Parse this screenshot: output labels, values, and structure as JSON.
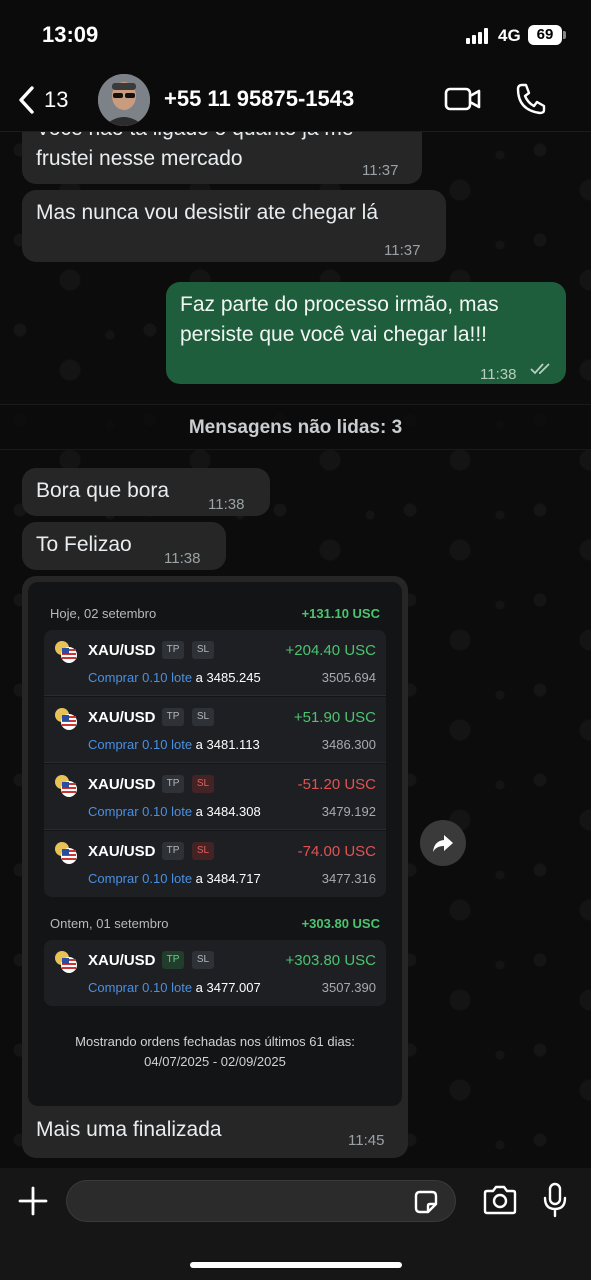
{
  "status_bar": {
    "time": "13:09",
    "network": "4G",
    "battery": "69"
  },
  "header": {
    "back_count": "13",
    "contact": "+55 11 95875-1543"
  },
  "messages": [
    {
      "type": "in",
      "text_line1": "Voce não ta ligado o quanto já me",
      "text_line2": "frustei nesse mercado",
      "time": "11:37"
    },
    {
      "type": "in",
      "text": "Mas nunca vou desistir ate chegar lá",
      "time": "11:37"
    },
    {
      "type": "out",
      "text_line1": "Faz parte do processo irmão, mas",
      "text_line2": "persiste que você vai chegar la!!!",
      "time": "11:38",
      "status": "read"
    },
    {
      "type": "in",
      "text": "Bora que bora",
      "time": "11:38"
    },
    {
      "type": "in",
      "text": "To Felizao",
      "time": "11:38"
    },
    {
      "type": "in-image",
      "caption": "Mais uma finalizada",
      "time": "11:45"
    }
  ],
  "unread_banner": "Mensagens não lidas: 3",
  "trading_screenshot": {
    "sections": [
      {
        "date": "Hoje, 02 setembro",
        "total": "+131.10 USC",
        "trades": [
          {
            "pair": "XAU/USD",
            "tp": "TP",
            "sl": "SL",
            "pnl": "+204.40 USC",
            "action": "Comprar 0.10 lote",
            "at": " a 3485.245",
            "close": "3505.694",
            "tp_state": "neutral",
            "sl_state": "neutral",
            "positive": true
          },
          {
            "pair": "XAU/USD",
            "tp": "TP",
            "sl": "SL",
            "pnl": "+51.90 USC",
            "action": "Comprar 0.10 lote",
            "at": " a 3481.113",
            "close": "3486.300",
            "tp_state": "neutral",
            "sl_state": "neutral",
            "positive": true
          },
          {
            "pair": "XAU/USD",
            "tp": "TP",
            "sl": "SL",
            "pnl": "-51.20 USC",
            "action": "Comprar 0.10 lote",
            "at": " a 3484.308",
            "close": "3479.192",
            "tp_state": "neutral",
            "sl_state": "red",
            "positive": false
          },
          {
            "pair": "XAU/USD",
            "tp": "TP",
            "sl": "SL",
            "pnl": "-74.00 USC",
            "action": "Comprar 0.10 lote",
            "at": " a 3484.717",
            "close": "3477.316",
            "tp_state": "neutral",
            "sl_state": "red",
            "positive": false
          }
        ]
      },
      {
        "date": "Ontem, 01 setembro",
        "total": "+303.80 USC",
        "trades": [
          {
            "pair": "XAU/USD",
            "tp": "TP",
            "sl": "SL",
            "pnl": "+303.80 USC",
            "action": "Comprar 0.10 lote",
            "at": " a 3477.007",
            "close": "3507.390",
            "tp_state": "green",
            "sl_state": "neutral",
            "positive": true
          }
        ]
      }
    ],
    "footnote_line1": "Mostrando ordens fechadas nos últimos 61 dias:",
    "footnote_line2": "04/07/2025 - 02/09/2025"
  },
  "colors": {
    "outgoing_bubble": "#1e5e3c",
    "incoming_bubble": "#262626",
    "profit": "#4cc46f",
    "loss": "#e05353",
    "link": "#4a90e2"
  }
}
